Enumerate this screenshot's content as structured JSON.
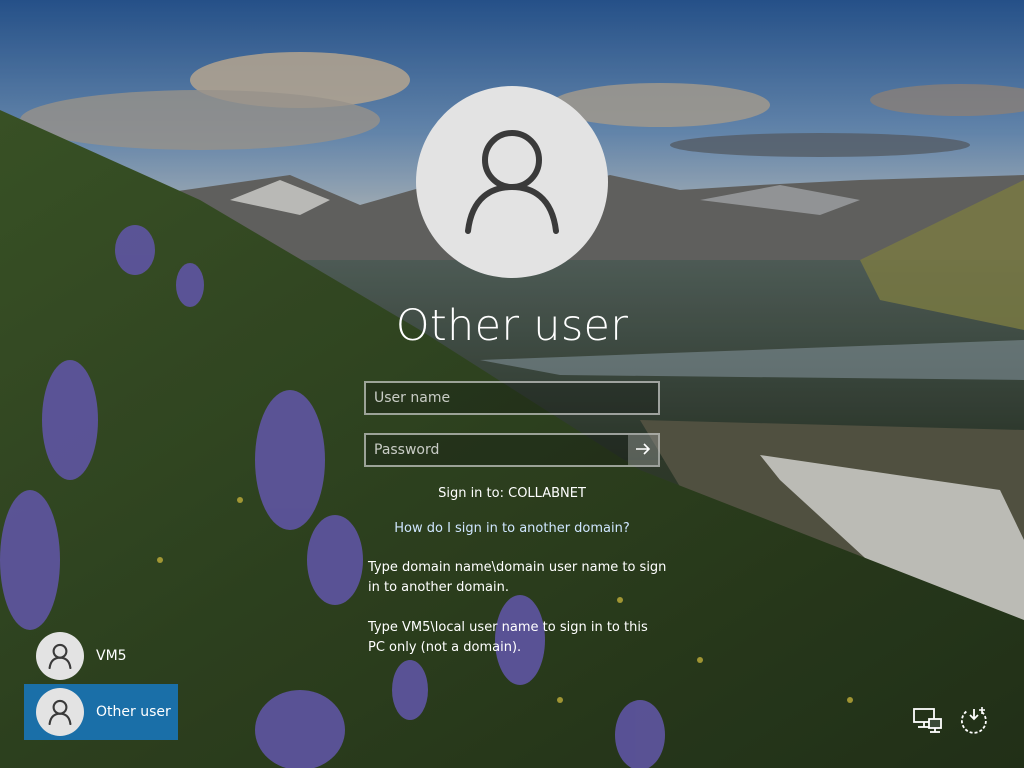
{
  "login": {
    "title": "Other user",
    "username_placeholder": "User name",
    "username_value": "",
    "password_placeholder": "Password",
    "password_value": "",
    "signin_to": "Sign in to: COLLABNET",
    "help_link": "How do I sign in to another domain?",
    "help_text_1": "Type domain name\\domain user name to sign in to another domain.",
    "help_text_2": "Type VM5\\local user name to sign in to this PC only (not a domain)."
  },
  "users": [
    {
      "label": "VM5",
      "icon": "user-icon",
      "selected": false
    },
    {
      "label": "Other user",
      "icon": "user-icon",
      "selected": true
    }
  ],
  "system_icons": [
    "network-icon",
    "ease-of-access-icon"
  ],
  "colors": {
    "selected_tile": "#1a6fa8",
    "avatar_bg": "#e3e3e3",
    "avatar_glyph": "#3a3a3a",
    "link": "#cfe6ff"
  }
}
